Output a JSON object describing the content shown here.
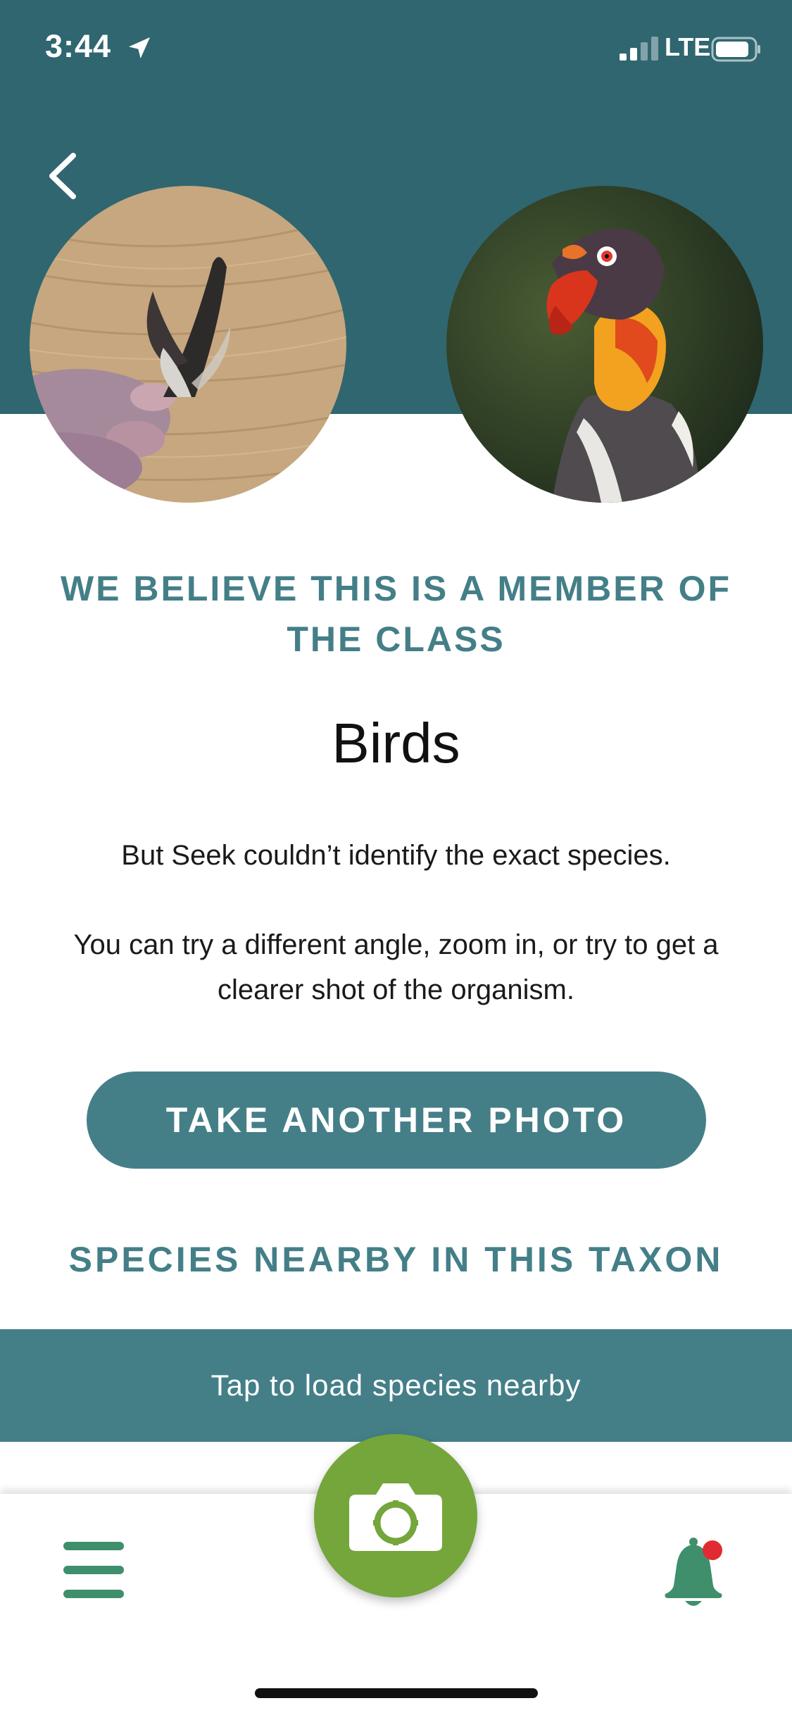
{
  "status_bar": {
    "time": "3:44",
    "network": "LTE",
    "location_icon": "location-arrow-icon",
    "signal_icon": "cellular-signal-icon",
    "battery_icon": "battery-icon"
  },
  "nav": {
    "back_icon": "chevron-left-icon"
  },
  "photos": {
    "user_photo": "feather-photo",
    "reference_photo": "king-vulture-photo"
  },
  "result": {
    "heading": "WE BELIEVE THIS IS A MEMBER OF THE CLASS",
    "taxon": "Birds",
    "message_1": "But Seek couldn’t identify the exact species.",
    "message_2": "You can try a different angle, zoom in, or try to get a clearer shot of the organism."
  },
  "actions": {
    "take_photo_label": "TAKE ANOTHER PHOTO"
  },
  "nearby": {
    "heading": "SPECIES NEARBY IN THIS TAXON",
    "load_label": "Tap to load species nearby"
  },
  "bottom_nav": {
    "menu_icon": "hamburger-menu-icon",
    "camera_icon": "camera-icon",
    "bell_icon": "notification-bell-icon"
  },
  "colors": {
    "header_teal": "#2f6670",
    "accent_teal": "#447f88",
    "camera_green": "#74a63b",
    "nav_green": "#3f8f6c",
    "badge_red": "#e02b32"
  }
}
